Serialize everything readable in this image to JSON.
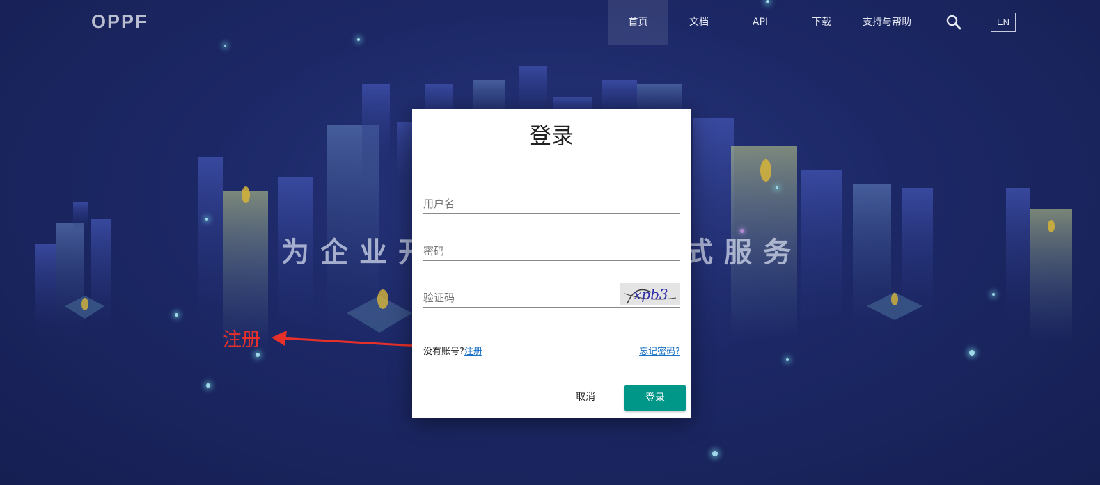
{
  "header": {
    "logo": "OPPF",
    "nav": [
      {
        "label": "首页",
        "active": true
      },
      {
        "label": "文档",
        "active": false
      },
      {
        "label": "API",
        "active": false
      },
      {
        "label": "下载",
        "active": false
      },
      {
        "label": "支持与帮助",
        "active": false
      }
    ],
    "search_icon": "search-icon",
    "lang_button": "EN"
  },
  "hero": {
    "left_text": "为企业开",
    "right_text": "站式服务"
  },
  "annotation": {
    "label": "注册",
    "color": "#e8302a"
  },
  "login": {
    "title": "登录",
    "username_placeholder": "用户名",
    "password_placeholder": "密码",
    "captcha_placeholder": "验证码",
    "captcha_text": "xpb3",
    "no_account_text": "没有账号?",
    "register_link": "注册",
    "forgot_link": "忘记密码?",
    "cancel_label": "取消",
    "login_label": "登录",
    "primary_color": "#009688"
  }
}
